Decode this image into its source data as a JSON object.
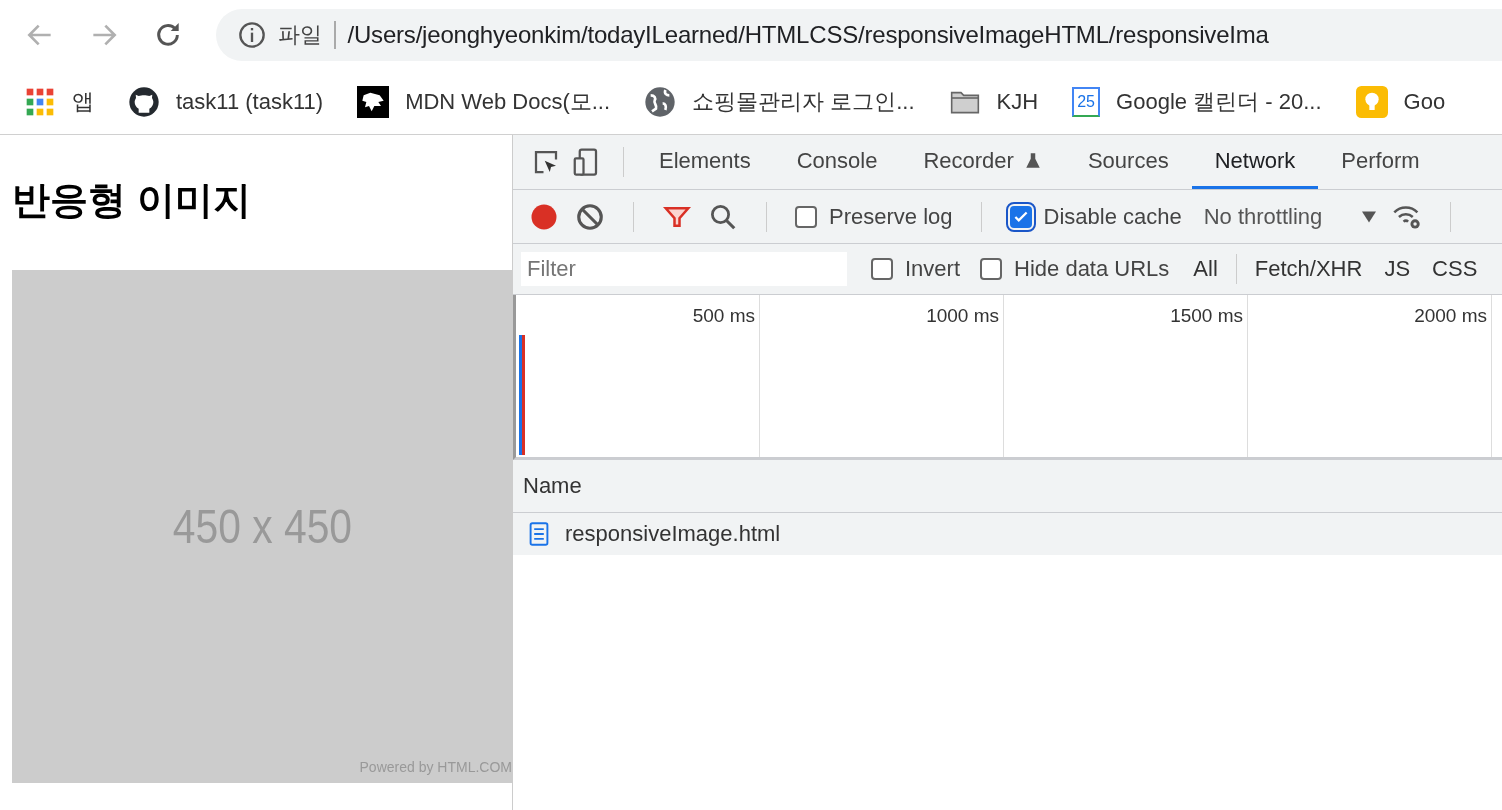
{
  "browser": {
    "address": {
      "scheme_label": "파일",
      "url": "/Users/jeonghyeonkim/todayILearned/HTMLCSS/responsiveImageHTML/responsiveIma"
    },
    "bookmarks": [
      {
        "kind": "apps",
        "label": "앱"
      },
      {
        "kind": "github",
        "label": "task11 (task11)"
      },
      {
        "kind": "mdn",
        "label": "MDN Web Docs(모..."
      },
      {
        "kind": "globe",
        "label": "쇼핑몰관리자 로그인..."
      },
      {
        "kind": "folder",
        "label": "KJH"
      },
      {
        "kind": "calendar",
        "label": "Google 캘린더 - 20...",
        "icon_text": "25"
      },
      {
        "kind": "bulb",
        "label": "Goo"
      }
    ]
  },
  "page": {
    "heading": "반응형 이미지",
    "image": {
      "size_text": "450 x 450",
      "credit": "Powered by HTML.COM"
    }
  },
  "devtools": {
    "tabs": [
      {
        "label": "Elements",
        "selected": false
      },
      {
        "label": "Console",
        "selected": false
      },
      {
        "label": "Recorder",
        "selected": false,
        "experimental": true
      },
      {
        "label": "Sources",
        "selected": false
      },
      {
        "label": "Network",
        "selected": true
      },
      {
        "label": "Perform",
        "selected": false
      }
    ],
    "toolbar": {
      "recording": true,
      "filter_active": true,
      "preserve_log": {
        "label": "Preserve log",
        "checked": false
      },
      "disable_cache": {
        "label": "Disable cache",
        "checked": true
      },
      "throttling": "No throttling"
    },
    "filter": {
      "placeholder": "Filter",
      "invert": {
        "label": "Invert",
        "checked": false
      },
      "hide_data_urls": {
        "label": "Hide data URLs",
        "checked": false
      },
      "types": [
        "All",
        "Fetch/XHR",
        "JS",
        "CSS"
      ]
    },
    "timeline_ticks": [
      "500 ms",
      "1000 ms",
      "1500 ms",
      "2000 ms"
    ],
    "table": {
      "columns": [
        "Name"
      ],
      "rows": [
        {
          "name": "responsiveImage.html"
        }
      ]
    }
  }
}
